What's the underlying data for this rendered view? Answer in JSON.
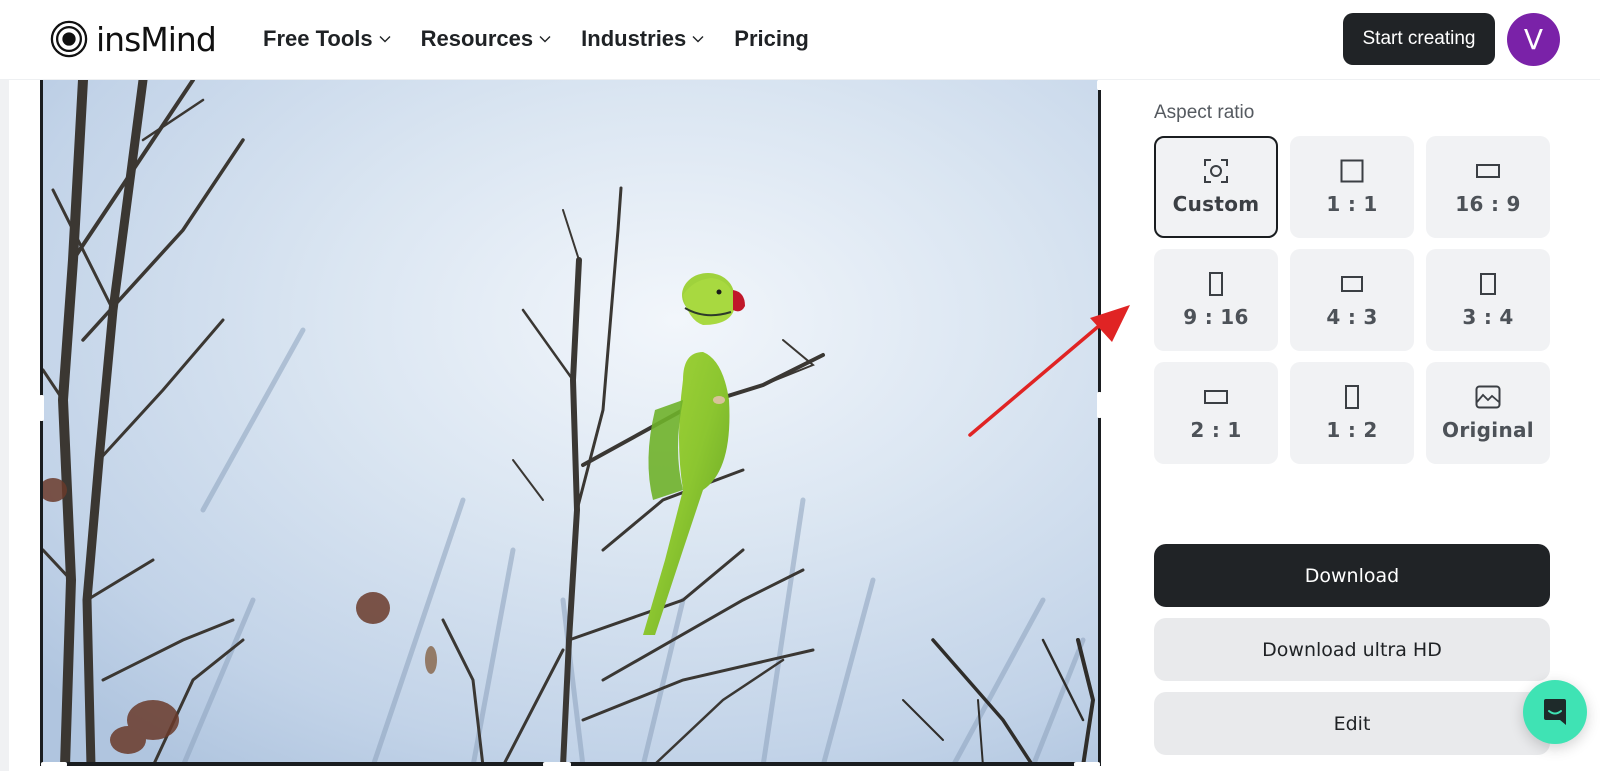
{
  "header": {
    "logo_text": "insMind",
    "nav": [
      {
        "label": "Free Tools",
        "has_dropdown": true
      },
      {
        "label": "Resources",
        "has_dropdown": true
      },
      {
        "label": "Industries",
        "has_dropdown": true
      },
      {
        "label": "Pricing",
        "has_dropdown": false
      }
    ],
    "start_button": "Start creating",
    "avatar_initial": "V",
    "avatar_color": "#7a22a8"
  },
  "canvas": {
    "image_description": "Green rose-ringed parakeet perched on bare tree branches against a pale blue sky",
    "crop_frame_active": true,
    "annotation": "red-arrow pointing to aspect ratio options"
  },
  "panel": {
    "aspect_ratio_label": "Aspect ratio",
    "ratios": [
      {
        "label": "Custom",
        "icon": "custom-crop-icon",
        "selected": true
      },
      {
        "label": "1 : 1",
        "icon": "square-icon",
        "selected": false
      },
      {
        "label": "16 : 9",
        "icon": "wide-rect-icon",
        "selected": false
      },
      {
        "label": "9 : 16",
        "icon": "tall-rect-icon",
        "selected": false
      },
      {
        "label": "4 : 3",
        "icon": "landscape-rect-icon",
        "selected": false
      },
      {
        "label": "3 : 4",
        "icon": "portrait-rect-icon",
        "selected": false
      },
      {
        "label": "2 : 1",
        "icon": "wide-rect-icon",
        "selected": false
      },
      {
        "label": "1 : 2",
        "icon": "tall-rect-icon",
        "selected": false
      },
      {
        "label": "Original",
        "icon": "image-icon",
        "selected": false
      }
    ],
    "buttons": {
      "download": "Download",
      "download_uhd": "Download ultra HD",
      "edit": "Edit"
    }
  },
  "colors": {
    "primary_dark": "#202326",
    "chat_accent": "#3fe3b4",
    "annotation_red": "#e02424"
  }
}
